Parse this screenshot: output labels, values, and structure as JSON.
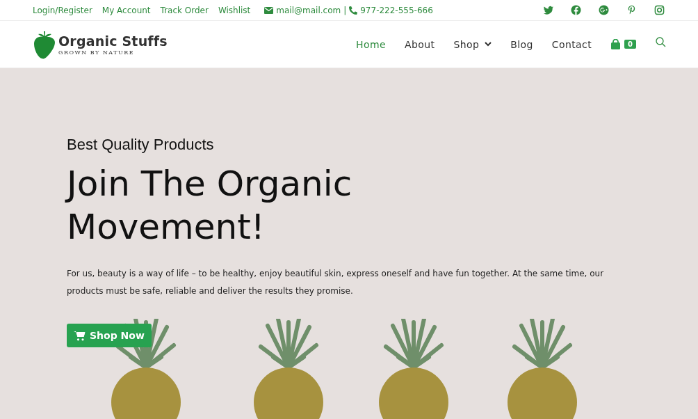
{
  "top_bar": {
    "links": [
      "Login/Register",
      "My Account",
      "Track Order",
      "Wishlist"
    ],
    "email": "mail@mail.com",
    "separator": "|",
    "phone": "977-222-555-666"
  },
  "header": {
    "logo": {
      "name": "Organic Stuffs",
      "tagline": "GROWN BY NATURE"
    },
    "nav": [
      {
        "label": "Home",
        "selected": true,
        "dropdown": false
      },
      {
        "label": "About",
        "selected": false,
        "dropdown": false
      },
      {
        "label": "Shop",
        "selected": false,
        "dropdown": true
      },
      {
        "label": "Blog",
        "selected": false,
        "dropdown": false
      },
      {
        "label": "Contact",
        "selected": false,
        "dropdown": false
      }
    ],
    "cart_count": "0"
  },
  "hero": {
    "subtitle": "Best Quality Products",
    "title": "Join The Organic Movement!",
    "text": "For us, beauty is a way of life – to be healthy, enjoy beautiful skin, express oneself and have fun together. At the same time, our products must be safe, reliable and deliver the results they promise.",
    "button": "Shop Now"
  }
}
